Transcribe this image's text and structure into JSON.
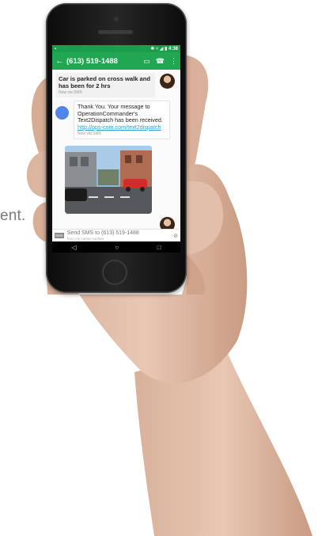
{
  "background_text": "ent.",
  "phone": {
    "statusbar": {
      "time": "4:38",
      "icons": [
        "bluetooth-icon",
        "wifi-icon",
        "signal-icon",
        "battery-icon"
      ]
    },
    "appbar": {
      "back_icon": "←",
      "title": "(613) 519-1488",
      "actions": [
        {
          "name": "video-call-icon",
          "glyph": "▭"
        },
        {
          "name": "phone-call-icon",
          "glyph": "☎"
        },
        {
          "name": "overflow-menu-icon",
          "glyph": "⋮"
        }
      ]
    },
    "messages": [
      {
        "type": "incoming",
        "text": "Car is parked on cross walk and has been for 2 hrs",
        "meta": "Now via SMS"
      },
      {
        "type": "outgoing",
        "text_before": "Thank You. Your message to OperationCommander's Text2Dispatch has been received. ",
        "link": "http://ops-com.com/text2dispatch",
        "meta": "Now via SMS"
      },
      {
        "type": "incoming-image"
      }
    ],
    "compose": {
      "badge": "SMS",
      "placeholder": "Send SMS to (613) 519-1488",
      "subtext": "from my carrier number"
    },
    "navbar": {
      "back": "◁",
      "home": "○",
      "recents": "□"
    }
  },
  "colors": {
    "appbar": "#21a652",
    "statusbar": "#1d9d4c",
    "link": "#2a9ad8"
  }
}
